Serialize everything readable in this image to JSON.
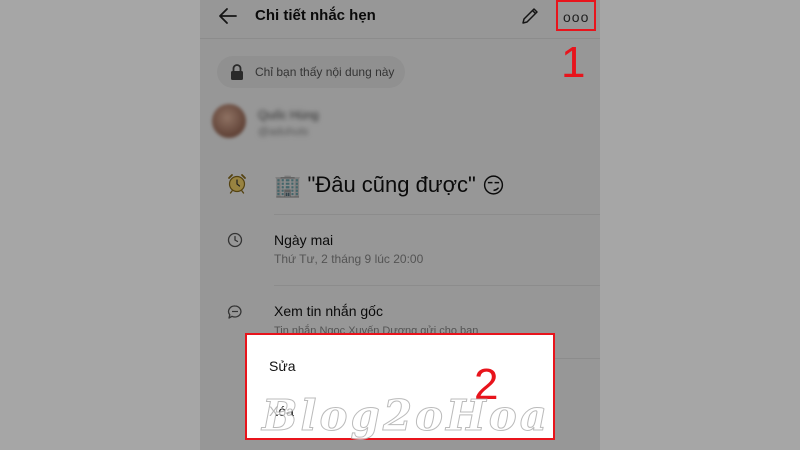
{
  "header": {
    "title": "Chi tiết nhắc hẹn",
    "more_label": "ooo"
  },
  "privacy": {
    "text": "Chỉ bạn thấy nội dung này"
  },
  "user": {
    "name": "Quốc Hùng",
    "handle": "@aduhuts"
  },
  "reminder": {
    "emoji_building": "🏢",
    "title_text": "\"Đâu cũng được\"",
    "emoji_face": "😏"
  },
  "schedule": {
    "main": "Ngày mai",
    "sub": "Thứ Tư, 2 tháng 9 lúc 20:00"
  },
  "original": {
    "main": "Xem tin nhắn gốc",
    "sub": "Tin nhắn Ngọc Xuyến Dương gửi cho bạn"
  },
  "menu": {
    "edit": "Sửa",
    "delete": "Xóa"
  },
  "annotations": {
    "step1": "1",
    "step2": "2"
  },
  "watermark": "Blog2oHoa",
  "colors": {
    "annotation_red": "#e8141c",
    "overlay": "#a6a6a6"
  }
}
